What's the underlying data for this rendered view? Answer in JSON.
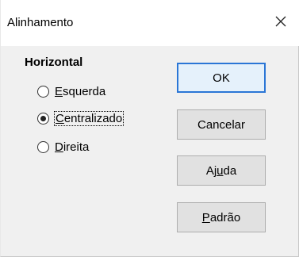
{
  "dialog": {
    "title": "Alinhamento",
    "close_label": "×"
  },
  "horizontal": {
    "group_title": "Horizontal",
    "options": [
      {
        "access": "E",
        "rest": "squerda",
        "selected": false
      },
      {
        "access": "C",
        "rest": "entralizado",
        "selected": true
      },
      {
        "access": "D",
        "rest": "ireita",
        "selected": false
      }
    ]
  },
  "buttons": {
    "ok": "OK",
    "cancel": "Cancelar",
    "help": {
      "before": "Aj",
      "access": "u",
      "after": "da"
    },
    "default": {
      "before": "",
      "access": "P",
      "after": "adrão"
    }
  },
  "colors": {
    "default_button_border": "#2b76d6",
    "window_background": "#f0f0f0",
    "titlebar_background": "#ffffff"
  }
}
